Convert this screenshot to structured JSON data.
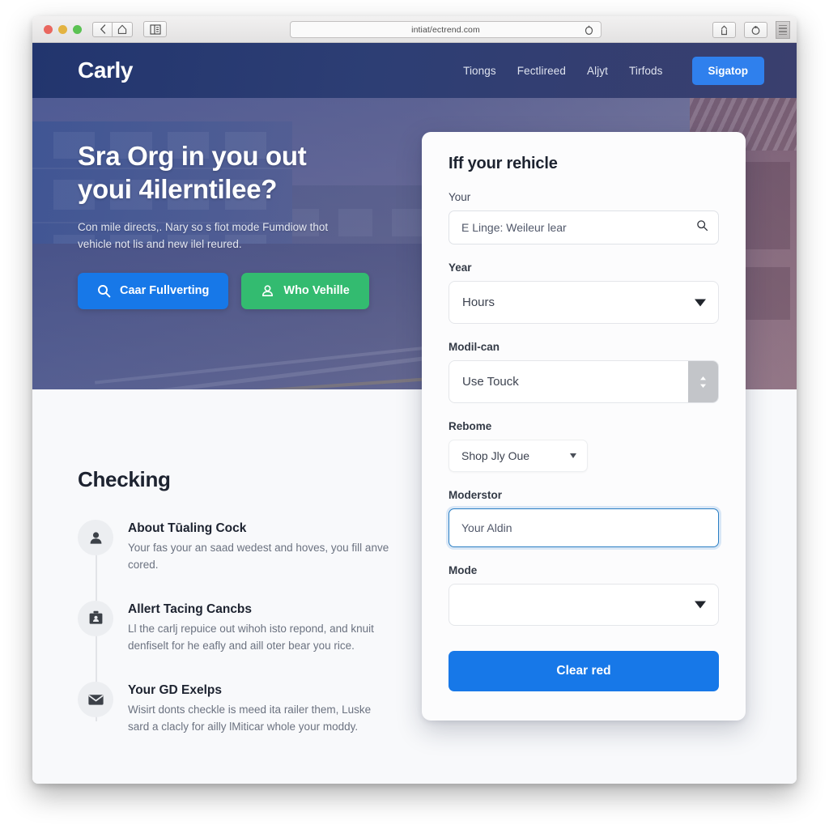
{
  "browser": {
    "url": "intiat/ectrend.com",
    "back_icon": "chevron-left-icon",
    "home_icon": "home-icon",
    "sidebar_icon": "reader-view-icon",
    "reload_icon": "reload-icon",
    "share_icon": "share-icon",
    "refresh_icon": "refresh-icon",
    "menu_icon": "menu-grid-icon"
  },
  "site_header": {
    "brand": "Carly",
    "nav": [
      {
        "label": "Tiongs"
      },
      {
        "label": "Fectlireed"
      },
      {
        "label": "Aljyt"
      },
      {
        "label": "Tirfods"
      }
    ],
    "signup_label": "Sigatop",
    "signup_color": "#2f80ed"
  },
  "hero": {
    "title_line1": "Sra Org in you out",
    "title_line2": "youi 4ilerntilee?",
    "subtitle_line1": "Con mile directs,. Nary so s fiot mode Fumdiow thot",
    "subtitle_line2": "vehicle not lis and new ilel reured.",
    "primary_button": {
      "label": "Caar Fullverting",
      "icon": "search-icon",
      "color": "#1778e8"
    },
    "secondary_button": {
      "label": "Who Vehille",
      "icon": "person-icon",
      "color": "#33bb70"
    }
  },
  "checking": {
    "title": "Checking",
    "items": [
      {
        "icon": "person-icon",
        "title": "About Tūaling Cock",
        "body": "Your fas your an saad wedest and hoves, you fill anve cored."
      },
      {
        "icon": "id-card-icon",
        "title": "Allert Tacing Cancbs",
        "body": "Ll the carlj repuice out wihoh isto repond, and knuit denfiselt for he eafly and aill oter bear you rice."
      },
      {
        "icon": "envelope-icon",
        "title": "Your GD Exelps",
        "body": "Wisirt donts checkle is meed ita railer them, Luske sard a clacly for ailly lMiticar whole your moddy."
      }
    ]
  },
  "form": {
    "title": "Iff your rehicle",
    "search": {
      "label": "Your",
      "placeholder": "E Linge: Weileur lear",
      "icon": "search-icon"
    },
    "year": {
      "label": "Year",
      "value": "Hours",
      "icon": "chevron-down-icon"
    },
    "model": {
      "label": "Modil-can",
      "value": "Use Touck",
      "icon": "stepper-updown-icon"
    },
    "rebome": {
      "label": "Rebome",
      "value": "Shop Jly Oue",
      "icon": "chevron-down-icon"
    },
    "moderstor": {
      "label": "Moderstor",
      "value": "Your Aldin",
      "focused": true
    },
    "mode": {
      "label": "Mode",
      "value": "",
      "icon": "chevron-down-icon"
    },
    "submit_label": "Clear red",
    "submit_color": "#1778e8"
  }
}
